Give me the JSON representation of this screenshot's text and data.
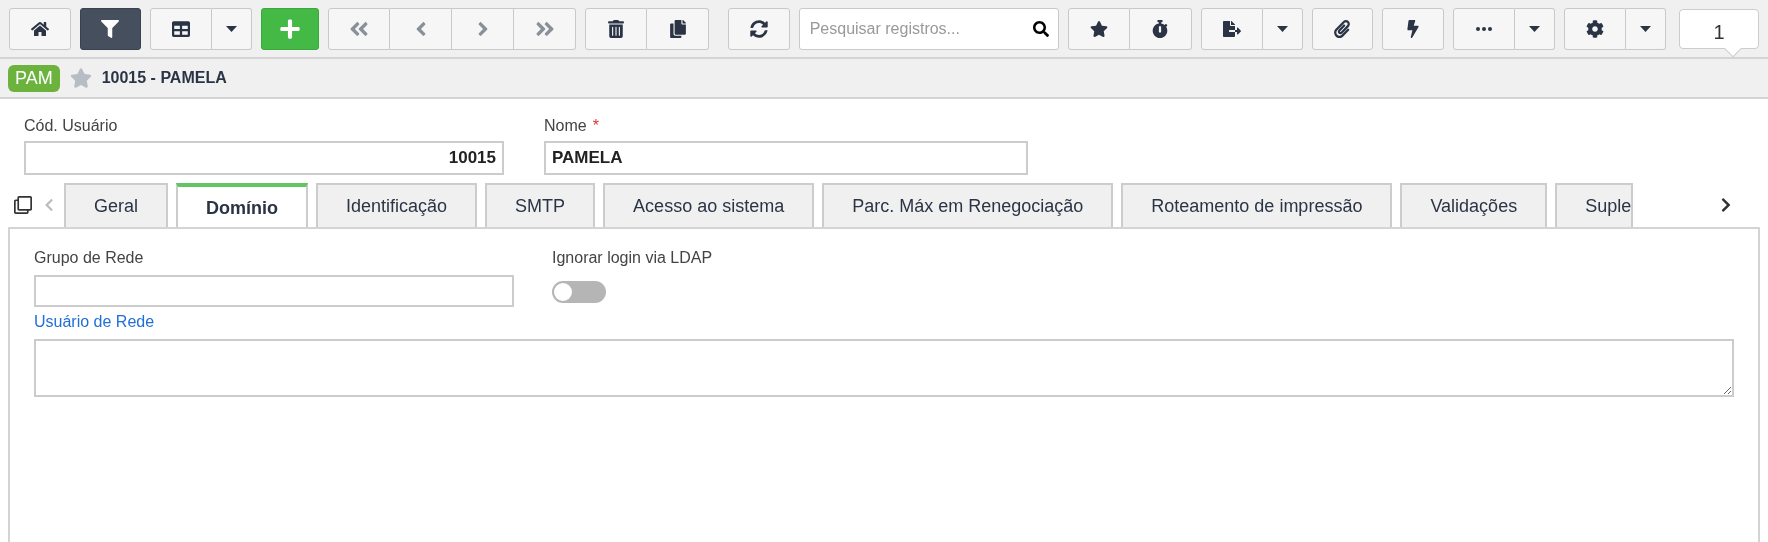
{
  "toolbar": {
    "filter_active": true,
    "search": {
      "placeholder": "Pesquisar registros..."
    },
    "page": "1"
  },
  "record": {
    "badge": "PAM",
    "favorite": false,
    "title": "10015 - PAMELA"
  },
  "fields": [
    {
      "label": "Cód. Usuário",
      "value": "10015",
      "kind": "number"
    },
    {
      "label": "Nome",
      "value": "PAMELA",
      "kind": "text",
      "required_mark": "*"
    }
  ],
  "tabs": [
    {
      "label": "Geral",
      "selected": false
    },
    {
      "label": "Domínio",
      "selected": true
    },
    {
      "label": "Identificação",
      "selected": false
    },
    {
      "label": "SMTP",
      "selected": false
    },
    {
      "label": "Acesso ao sistema",
      "selected": false
    },
    {
      "label": "Parc. Máx em Renegociação",
      "selected": false
    },
    {
      "label": "Roteamento de impressão",
      "selected": false
    },
    {
      "label": "Validações",
      "selected": false
    },
    {
      "label": "Suple",
      "selected": false
    }
  ],
  "panel": {
    "grupo_de_rede": {
      "label": "Grupo de Rede"
    },
    "ignorar_login": {
      "label": "Ignorar login via LDAP",
      "on": false
    },
    "usuario_de_rede": {
      "label": "Usuário de Rede",
      "focused": true
    }
  }
}
